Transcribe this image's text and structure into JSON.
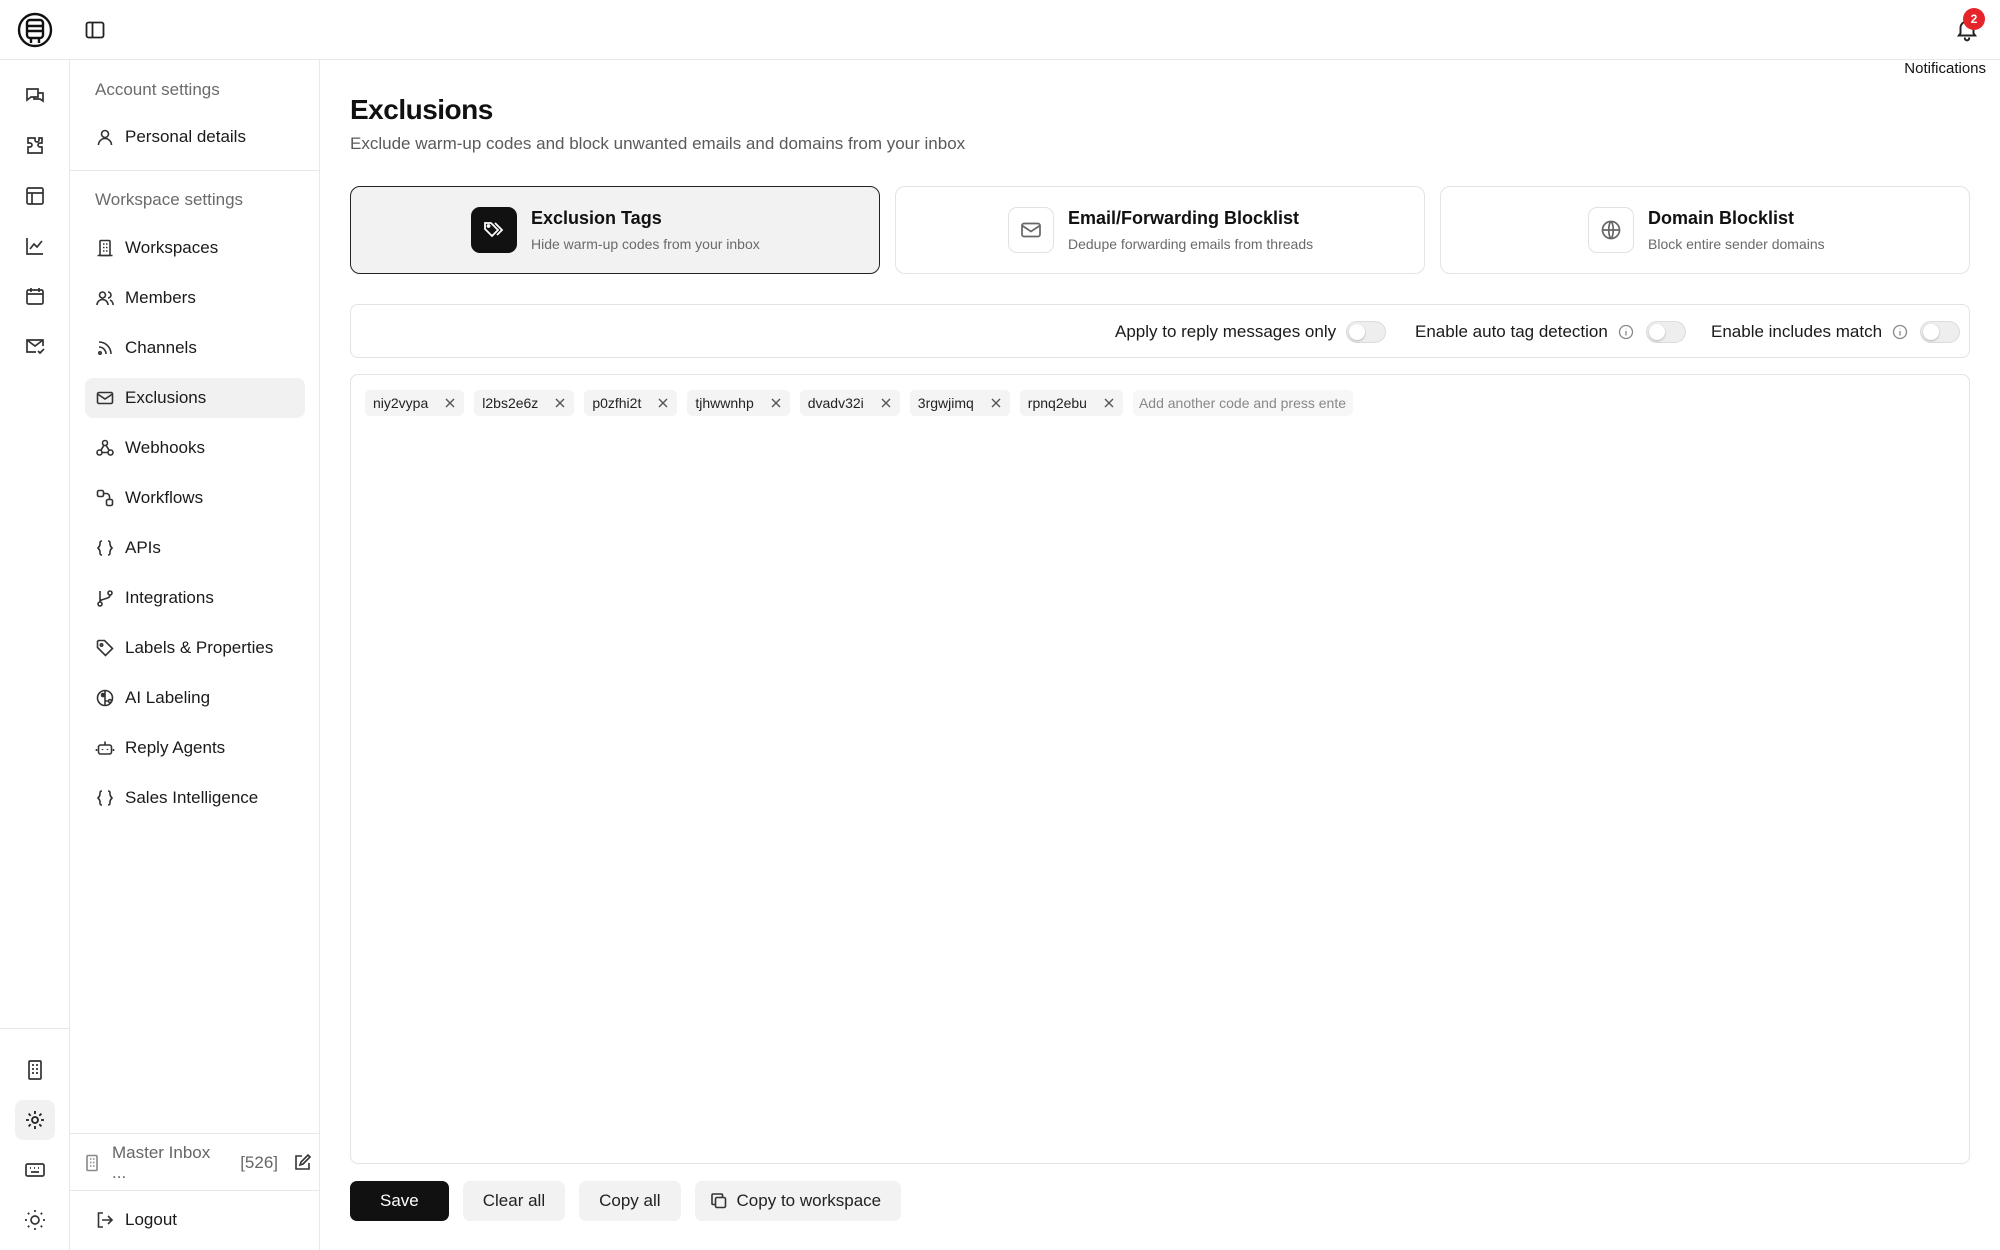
{
  "topbar": {
    "notifications_label": "Notifications",
    "notifications_count": "2"
  },
  "sidebar": {
    "account_label": "Account settings",
    "account_items": [
      {
        "label": "Personal details",
        "icon": "user-icon"
      }
    ],
    "workspace_label": "Workspace settings",
    "workspace_items": [
      {
        "label": "Workspaces",
        "icon": "building-icon"
      },
      {
        "label": "Members",
        "icon": "users-icon"
      },
      {
        "label": "Channels",
        "icon": "rss-icon"
      },
      {
        "label": "Exclusions",
        "icon": "mail-icon"
      },
      {
        "label": "Webhooks",
        "icon": "webhook-icon"
      },
      {
        "label": "Workflows",
        "icon": "workflow-icon"
      },
      {
        "label": "APIs",
        "icon": "braces-icon"
      },
      {
        "label": "Integrations",
        "icon": "git-branch-icon"
      },
      {
        "label": "Labels & Properties",
        "icon": "tag-icon"
      },
      {
        "label": "AI Labeling",
        "icon": "brain-icon"
      },
      {
        "label": "Reply Agents",
        "icon": "bot-icon"
      },
      {
        "label": "Sales Intelligence",
        "icon": "braces-icon"
      }
    ],
    "active_item": "Exclusions",
    "inbox": {
      "name": "Master Inbox ...",
      "count": "[526]"
    },
    "logout_label": "Logout"
  },
  "main": {
    "title": "Exclusions",
    "subtitle": "Exclude warm-up codes and block unwanted emails and domains from your inbox",
    "cards": [
      {
        "title": "Exclusion Tags",
        "desc": "Hide warm-up codes from your inbox",
        "icon": "tags-icon"
      },
      {
        "title": "Email/Forwarding Blocklist",
        "desc": "Dedupe forwarding emails from threads",
        "icon": "mail-icon"
      },
      {
        "title": "Domain Blocklist",
        "desc": "Block entire sender domains",
        "icon": "globe-icon"
      }
    ],
    "options": [
      {
        "label": "Apply to reply messages only",
        "enabled": false
      },
      {
        "label": "Enable auto tag detection",
        "enabled": false
      },
      {
        "label": "Enable includes match",
        "enabled": false
      }
    ],
    "tags": [
      "niy2vypa",
      "l2bs2e6z",
      "p0zfhi2t",
      "tjhwwnhp",
      "dvadv32i",
      "3rgwjimq",
      "rpnq2ebu"
    ],
    "tag_input_placeholder": "Add another code and press enter",
    "buttons": {
      "save": "Save",
      "clear_all": "Clear all",
      "copy_all": "Copy all",
      "copy_to_workspace": "Copy to workspace"
    }
  },
  "colors": {
    "primary": "#111111",
    "badge": "#e5252a",
    "active_bg": "#f1f1f1"
  }
}
